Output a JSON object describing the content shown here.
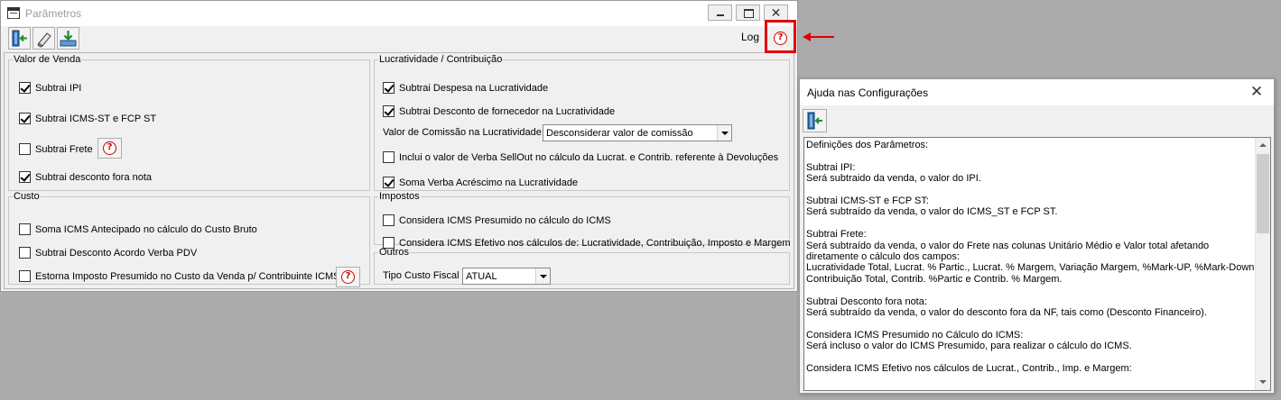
{
  "main_window": {
    "title": "Parâmetros",
    "window_buttons": {
      "close": "✕"
    },
    "toolbar": {
      "log_label": "Log",
      "help_label": "?"
    }
  },
  "groups": {
    "valor_venda": {
      "legend": "Valor de Venda",
      "items": [
        {
          "label": "Subtrai IPI",
          "checked": true
        },
        {
          "label": "Subtrai ICMS-ST e FCP ST",
          "checked": true
        },
        {
          "label": "Subtrai Frete",
          "checked": false
        },
        {
          "label": "Subtrai desconto fora nota",
          "checked": true
        }
      ]
    },
    "lucratividade": {
      "legend": "Lucratividade / Contribuição",
      "items": [
        {
          "label": "Subtrai Despesa na Lucratividade",
          "checked": true
        },
        {
          "label": "Subtrai Desconto de fornecedor na Lucratividade",
          "checked": true
        },
        {
          "label": "Inclui o valor de Verba SellOut no cálculo da Lucrat. e Contrib. referente à Devoluções",
          "checked": false
        },
        {
          "label": "Soma Verba Acréscimo na Lucratividade",
          "checked": true
        }
      ],
      "comissao_label": "Valor de Comissão na Lucratividade:",
      "comissao_value": "Desconsiderar valor de comissão"
    },
    "custo": {
      "legend": "Custo",
      "items": [
        {
          "label": "Soma ICMS Antecipado no cálculo do Custo Bruto",
          "checked": false
        },
        {
          "label": "Subtrai Desconto Acordo Verba PDV",
          "checked": false
        },
        {
          "label": "Estorna Imposto Presumido no Custo da Venda p/ Contribuinte ICMS",
          "checked": false
        }
      ]
    },
    "impostos": {
      "legend": "Impostos",
      "items": [
        {
          "label": "Considera ICMS Presumido no cálculo do ICMS",
          "checked": false
        },
        {
          "label": "Considera ICMS Efetivo nos cálculos de: Lucratividade, Contribuição, Imposto e Margem",
          "checked": false
        }
      ]
    },
    "outros": {
      "legend": "Outros",
      "tipo_custo_label": "Tipo Custo Fiscal",
      "tipo_custo_value": "ATUAL"
    }
  },
  "help_window": {
    "title": "Ajuda nas Configurações",
    "close": "✕",
    "lines": [
      "Definições dos Parâmetros:",
      "",
      "Subtrai IPI:",
      "Será subtraido da venda, o valor do IPI.",
      "",
      "Subtrai ICMS-ST e FCP ST:",
      "Será subtraído da venda, o valor do ICMS_ST e FCP ST.",
      "",
      "Subtrai Frete:",
      "Será subtraído da venda, o valor do Frete nas colunas Unitário Médio e Valor total afetando",
      "diretamente o cálculo dos campos:",
      "Lucratividade Total, Lucrat. % Partic., Lucrat. % Margem, Variação Margem, %Mark-UP, %Mark-Down,",
      "Contribuição Total, Contrib. %Partic e Contrib. % Margem.",
      "",
      "Subtrai Desconto fora nota:",
      "Será subtraído da venda, o valor do desconto fora da NF, tais como (Desconto Financeiro).",
      "",
      "Considera ICMS Presumido no Cálculo do ICMS:",
      "Será incluso o valor do ICMS Presumido, para realizar o cálculo do ICMS.",
      "",
      "Considera ICMS Efetivo nos cálculos de Lucrat., Contrib., Imp. e Margem:"
    ]
  },
  "colors": {
    "highlight": "#e00000",
    "help_icon": "#cc0000",
    "background": "#ababab"
  }
}
